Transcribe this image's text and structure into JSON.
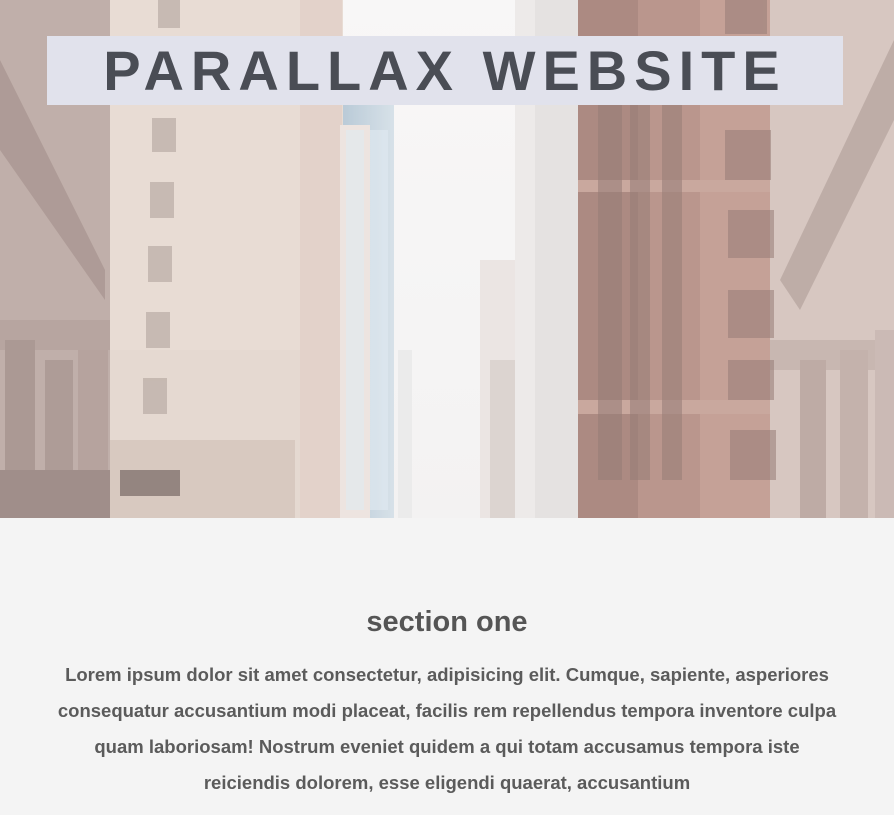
{
  "hero": {
    "title": "PARALLAX WEBSITE",
    "image": "city-street-skyscrapers-photo"
  },
  "section_one": {
    "heading": "section one",
    "body": "Lorem ipsum dolor sit amet consectetur, adipisicing elit. Cumque, sapiente, asperiores consequatur accusantium modi placeat, facilis rem repellendus tempora inventore culpa quam laboriosam! Nostrum eveniet quidem a qui totam accusamus tempora iste reiciendis dolorem, esse eligendi quaerat, accusantium"
  },
  "colors": {
    "page_background": "#f4f4f4",
    "title_band": "#e1e2ec",
    "title_text": "#4a4d55",
    "body_text": "#555555"
  }
}
